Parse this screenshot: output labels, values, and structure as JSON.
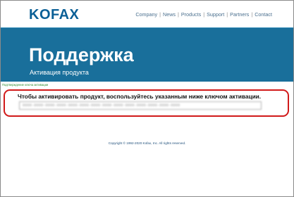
{
  "header": {
    "logo": "KOFAX",
    "nav": [
      {
        "label": "Company"
      },
      {
        "label": "News"
      },
      {
        "label": "Products"
      },
      {
        "label": "Support"
      },
      {
        "label": "Partners"
      },
      {
        "label": "Contact"
      }
    ],
    "separator": "|"
  },
  "banner": {
    "title": "Поддержка",
    "subtitle": "Активация продукта"
  },
  "main": {
    "confirm_label": "Подтверждение ключа активации",
    "instruction": "Чтобы активировать продукт, воспользуйтесь указанным ниже ключом активации.",
    "activation_key": "0000-0000-0000-0000-0000-0000-0000-0000-0000-0000-0000-0000-0000-0000"
  },
  "footer": {
    "copyright": "Copyright © 1992-2020 Kofax, Inc. All rights reserved."
  },
  "colors": {
    "brand_blue": "#0a5f96",
    "banner_blue": "#196f9b",
    "highlight_red": "#d11a1a",
    "confirm_green": "#2e8b2e"
  }
}
